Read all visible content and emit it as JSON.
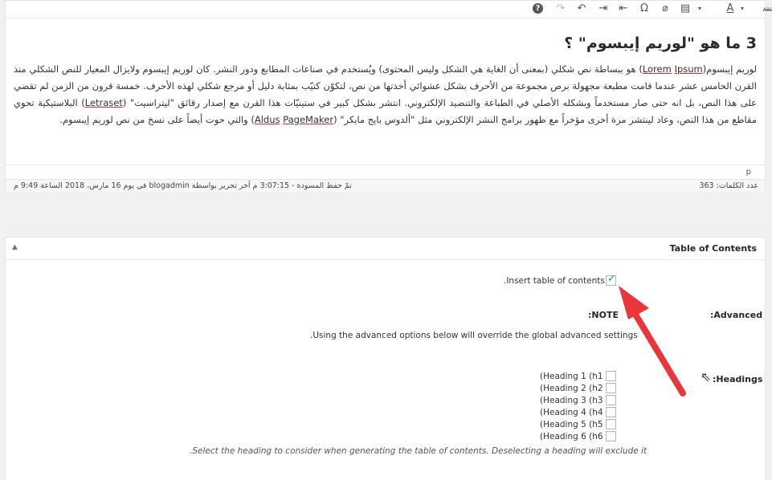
{
  "toolbar": {
    "buttons": [
      {
        "name": "help-icon",
        "glyph": "?"
      },
      {
        "name": "redo-icon",
        "glyph": "↷"
      },
      {
        "name": "undo-icon",
        "glyph": "↶"
      },
      {
        "name": "indent-icon",
        "glyph": "⇥"
      },
      {
        "name": "outdent-icon",
        "glyph": "⇤"
      },
      {
        "name": "special-char-icon",
        "glyph": "Ω"
      },
      {
        "name": "clear-format-icon",
        "glyph": "⌫"
      },
      {
        "name": "paste-text-icon",
        "glyph": "▤"
      },
      {
        "name": "text-color-icon",
        "glyph": "A"
      },
      {
        "name": "strikethrough-icon",
        "glyph": "ABC"
      }
    ]
  },
  "editor": {
    "title": "3 ما هو \"لوريم إيبسوم\" ؟",
    "body_intro": "لوريم إيبسوم(",
    "lorem": "Lorem",
    "ipsum": "Ipsum",
    "body_1": ") هو ببساطة نص شكلي (بمعنى أن الغاية هي الشكل وليس المحتوى) ويُستخدم في صناعات المطابع ودور النشر. كان لوريم إيبسوم ولايزال المعيار للنص الشكلي منذ القرن الخامس عشر عندما قامت مطبعة مجهولة برص مجموعة من الأحرف بشكل عشوائي أخذتها من نص، لتكوّن كتيّب بمثابة دليل أو مرجع شكلي لهذه الأحرف. خمسة قرون من الزمن لم تقضي على هذا النص، بل انه حتى صار مستخدماً وبشكله الأصلي في الطباعة والتنضيد الإلكتروني. انتشر بشكل كبير في ستينيّات هذا القرن مع إصدار رقائق \"ليتراسيت\" (",
    "letraset": "Letraset",
    "body_2": ") البلاستيكية تحوي مقاطع من هذا النص، وعاد لينتشر مرة أخرى مؤخراً مع ظهور برامج النشر الإلكتروني مثل \"ألدوس بايج مايكر\" (",
    "aldus": "Aldus",
    "pagemaker": "PageMaker",
    "body_3": ") والتي حوت أيضاً على نسخ من نص لوريم إيبسوم.",
    "path": "p"
  },
  "status": {
    "word_count": "عدد الكلمات: 363",
    "last_modified": "تمّ حفظ المسودة - 3:07:15 م آخر تحرير بواسطة blogadmin في يوم 16 مارس، 2018 الساعة 9:49 م"
  },
  "toc": {
    "title": "Table of Contents",
    "toggle": "▲",
    "insert_label": ".Insert table of contents",
    "insert_checked": true,
    "advanced_label": ":Advanced",
    "note_label": ":NOTE",
    "note_text": ".Using the advanced options below will override the global advanced settings",
    "headings_label": ":Headings",
    "headings": [
      {
        "label": "(Heading 1 (h1",
        "checked": false
      },
      {
        "label": "(Heading 2 (h2",
        "checked": false
      },
      {
        "label": "(Heading 3 (h3",
        "checked": false
      },
      {
        "label": "(Heading 4 (h4",
        "checked": false
      },
      {
        "label": "(Heading 5 (h5",
        "checked": false
      },
      {
        "label": "(Heading 6 (h6",
        "checked": false
      }
    ],
    "headings_desc": ".Select the heading to consider when generating the table of contents. Deselecting a heading will exclude it"
  },
  "colors": {
    "arrow": "#e8363b",
    "checkbox_check": "#1e8cbe"
  }
}
